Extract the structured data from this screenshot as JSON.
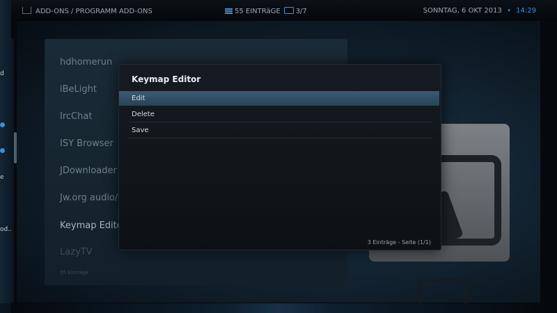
{
  "header": {
    "breadcrumb": "ADD-ONS / PROGRAMM ADD-ONS",
    "items_count": "55 EINTRäGE",
    "page": "3/7",
    "date": "SONNTAG, 6 OKT 2013",
    "separator": "•",
    "time": "14:29"
  },
  "sidebar": {
    "partial_labels": [
      "d",
      "e",
      "od..."
    ]
  },
  "list": {
    "items": [
      "hdhomerun",
      "iBeLight",
      "IrcChat",
      "ISY Browser",
      "JDownloader",
      "Jw.org audio/",
      "Keymap Edito",
      "LazyTV"
    ],
    "count": "55 Einträge"
  },
  "dialog": {
    "title": "Keymap Editor",
    "options": [
      "Edit",
      "Delete",
      "Save"
    ],
    "footer": "3 Einträge - Seite (1/1)"
  },
  "colors": {
    "accent": "#3a8fd8",
    "selection": "#2f4c62"
  }
}
